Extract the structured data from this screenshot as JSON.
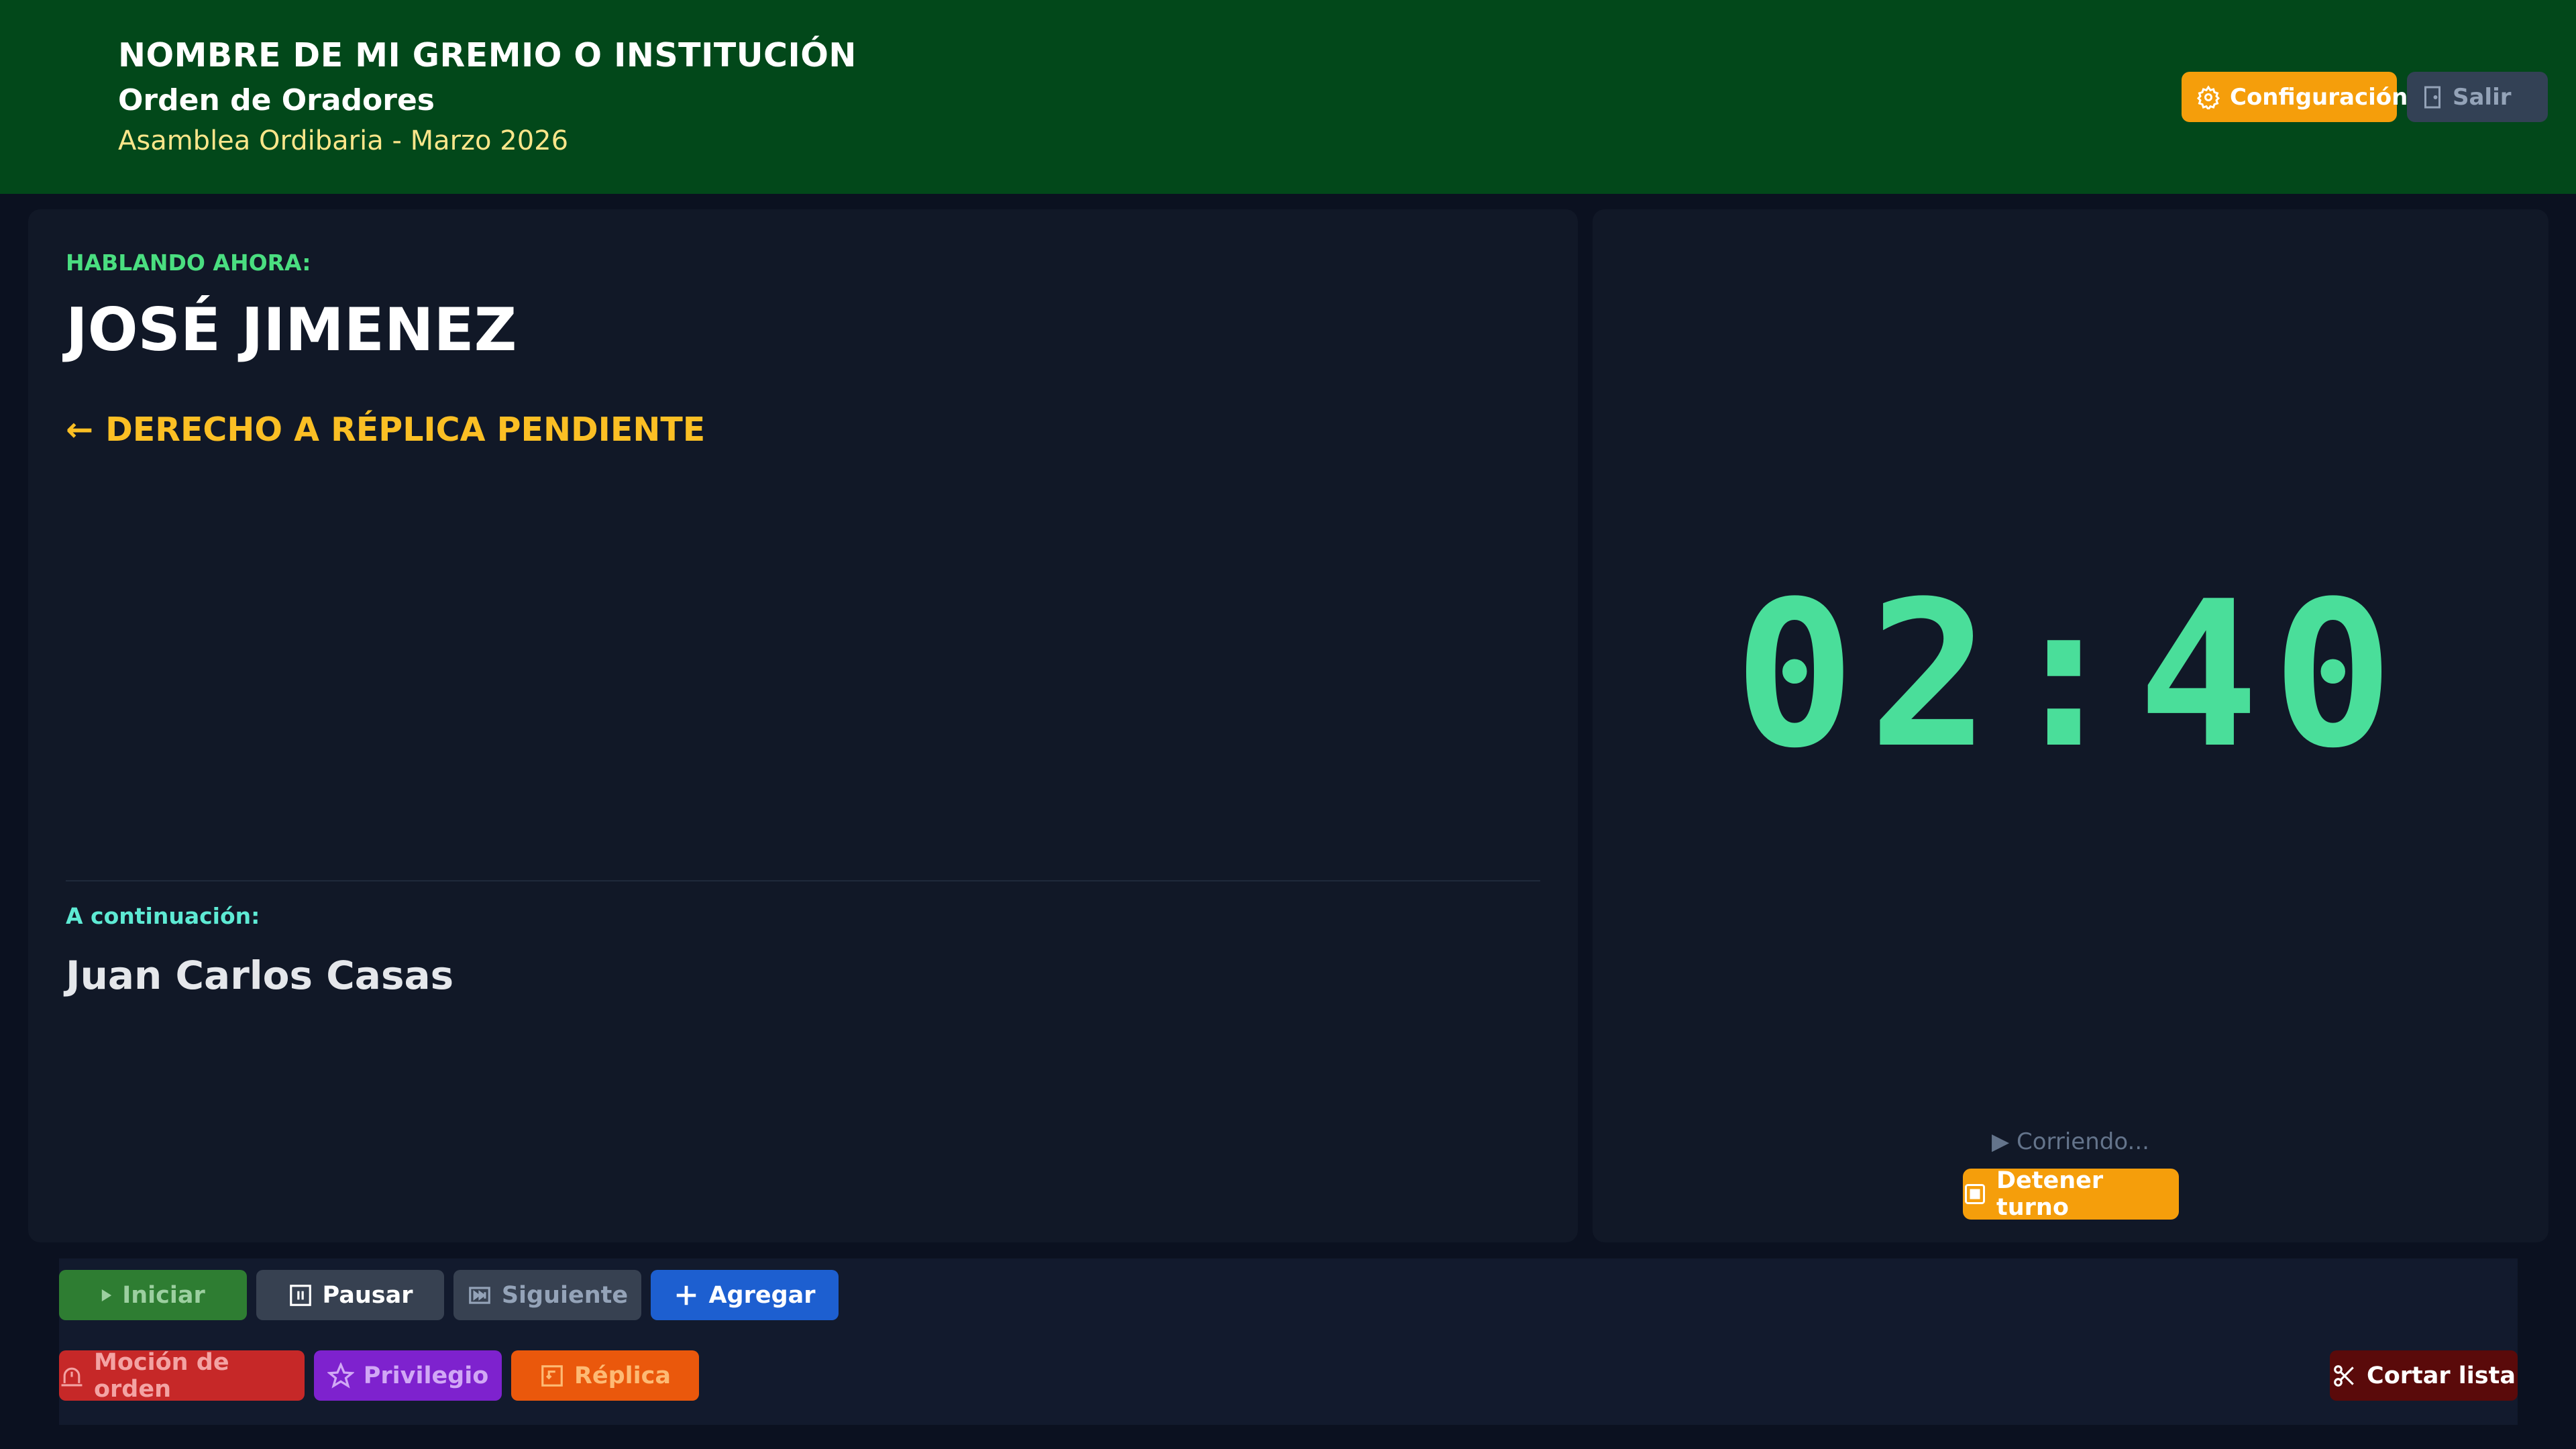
{
  "header": {
    "org_name": "NOMBRE DE MI GREMIO O INSTITUCIÓN",
    "subtitle": "Orden de Oradores",
    "session": "Asamblea Ordibaria - Marzo 2026",
    "config_label": "Configuración",
    "exit_label": "Salir"
  },
  "current": {
    "label": "HABLANDO AHORA:",
    "name": "JOSÉ JIMENEZ",
    "replica_notice": "DERECHO A RÉPLICA PENDIENTE",
    "replica_icon": "←"
  },
  "next": {
    "label": "A continuación:",
    "name": "Juan Carlos Casas"
  },
  "timer": {
    "value": "02:40",
    "status": "▶ Corriendo...",
    "stop_label": "Detener turno"
  },
  "controls": {
    "start_label": "Iniciar",
    "pause_label": "Pausar",
    "next_label": "Siguiente",
    "add_label": "Agregar",
    "motion_label": "Moción de orden",
    "privilege_label": "Privilegio",
    "replica_label": "Réplica",
    "cut_label": "Cortar lista"
  },
  "colors": {
    "header_bg": "#02481a",
    "accent_orange": "#f59e0b",
    "timer_green": "#4ade9a",
    "speaking_label": "#4ade80",
    "replica_notice": "#fbbf24",
    "next_label": "#5eead4"
  }
}
